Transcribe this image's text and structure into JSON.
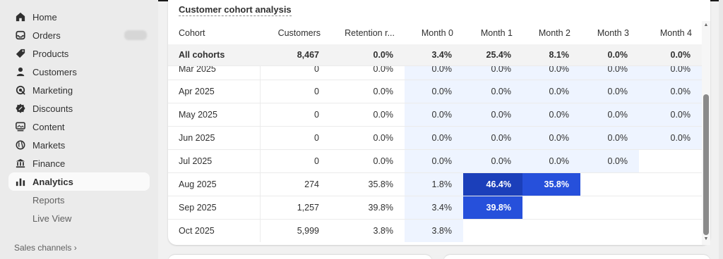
{
  "sidebar": {
    "items": [
      {
        "label": "Home",
        "icon": "home-icon"
      },
      {
        "label": "Orders",
        "icon": "inbox-icon"
      },
      {
        "label": "Products",
        "icon": "tag-icon"
      },
      {
        "label": "Customers",
        "icon": "person-icon"
      },
      {
        "label": "Marketing",
        "icon": "target-icon"
      },
      {
        "label": "Discounts",
        "icon": "discount-icon"
      },
      {
        "label": "Content",
        "icon": "content-icon"
      },
      {
        "label": "Markets",
        "icon": "globe-icon"
      },
      {
        "label": "Finance",
        "icon": "bank-icon"
      },
      {
        "label": "Analytics",
        "icon": "bar-chart-icon"
      }
    ],
    "sub_items": [
      "Reports",
      "Live View"
    ],
    "sales_channels": "Sales channels ›"
  },
  "card": {
    "title": "Customer cohort analysis"
  },
  "table": {
    "headers": [
      "Cohort",
      "Customers",
      "Retention r...",
      "Month 0",
      "Month 1",
      "Month 2",
      "Month 3",
      "Month 4"
    ],
    "all_row": [
      "All cohorts",
      "8,467",
      "0.0%",
      "3.4%",
      "25.4%",
      "8.1%",
      "0.0%",
      "0.0%"
    ],
    "rows": [
      [
        "Mar 2025",
        "0",
        "0.0%",
        "0.0%",
        "0.0%",
        "0.0%",
        "0.0%",
        "0.0%"
      ],
      [
        "Apr 2025",
        "0",
        "0.0%",
        "0.0%",
        "0.0%",
        "0.0%",
        "0.0%",
        "0.0%"
      ],
      [
        "May 2025",
        "0",
        "0.0%",
        "0.0%",
        "0.0%",
        "0.0%",
        "0.0%",
        "0.0%"
      ],
      [
        "Jun 2025",
        "0",
        "0.0%",
        "0.0%",
        "0.0%",
        "0.0%",
        "0.0%",
        "0.0%"
      ],
      [
        "Jul 2025",
        "0",
        "0.0%",
        "0.0%",
        "0.0%",
        "0.0%",
        "0.0%",
        ""
      ],
      [
        "Aug 2025",
        "274",
        "35.8%",
        "1.8%",
        "46.4%",
        "35.8%",
        "",
        ""
      ],
      [
        "Sep 2025",
        "1,257",
        "39.8%",
        "3.4%",
        "39.8%",
        "",
        "",
        ""
      ],
      [
        "Oct 2025",
        "5,999",
        "3.8%",
        "3.8%",
        "",
        "",
        "",
        ""
      ]
    ]
  },
  "colors": {
    "heat_light": "#eef4ff",
    "heat_dark": "#1b3fba",
    "heat_mid": "#2650db"
  }
}
